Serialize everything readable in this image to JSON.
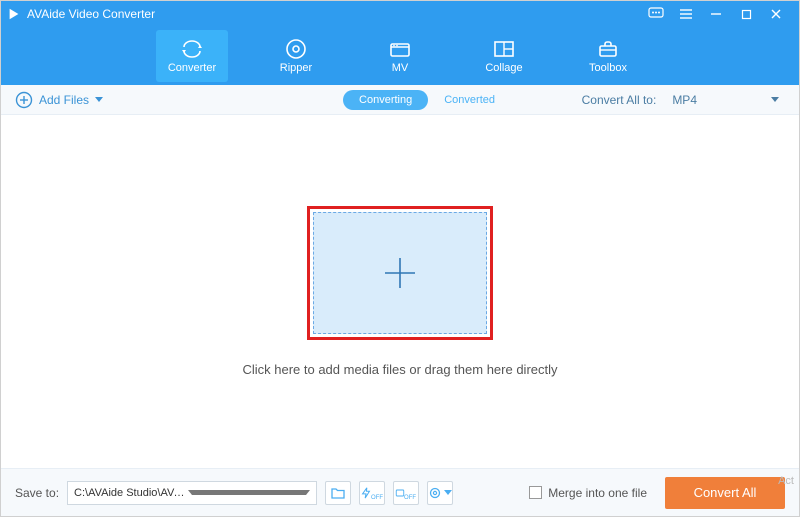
{
  "titlebar": {
    "title": "AVAide Video Converter"
  },
  "nav": {
    "converter": "Converter",
    "ripper": "Ripper",
    "mv": "MV",
    "collage": "Collage",
    "toolbox": "Toolbox"
  },
  "secbar": {
    "add_files": "Add Files",
    "converting": "Converting",
    "converted": "Converted",
    "convert_all_to": "Convert All to:",
    "format": "MP4"
  },
  "main": {
    "drop_text": "Click here to add media files or drag them here directly"
  },
  "bottom": {
    "save_to_label": "Save to:",
    "save_to_path": "C:\\AVAide Studio\\AVAid...eo Converter\\Converted",
    "merge_label": "Merge into one file",
    "convert_all": "Convert All"
  },
  "watermark": "Act"
}
